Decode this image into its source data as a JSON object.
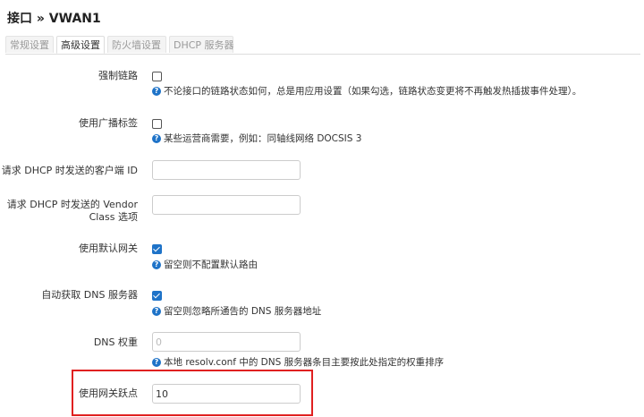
{
  "page": {
    "title": "接口 » VWAN1"
  },
  "tabs": [
    {
      "label": "常规设置",
      "active": false
    },
    {
      "label": "高级设置",
      "active": true
    },
    {
      "label": "防火墙设置",
      "active": false
    },
    {
      "label": "DHCP 服务器",
      "active": false
    }
  ],
  "fields": {
    "force_link": {
      "label": "强制链路",
      "checked": false,
      "help": "不论接口的链路状态如何，总是用应用设置（如果勾选，链路状态变更将不再触发热插拔事件处理）。"
    },
    "broadcast_flag": {
      "label": "使用广播标签",
      "checked": false,
      "help": "某些运营商需要，例如：同轴线网络 DOCSIS 3"
    },
    "client_id": {
      "label": "请求 DHCP 时发送的客户端 ID",
      "value": ""
    },
    "vendor_class": {
      "label_line1": "请求 DHCP 时发送的 Vendor",
      "label_line2": "Class 选项",
      "value": ""
    },
    "default_route": {
      "label": "使用默认网关",
      "checked": true,
      "help": "留空则不配置默认路由"
    },
    "peer_dns": {
      "label": "自动获取 DNS 服务器",
      "checked": true,
      "help": "留空则忽略所通告的 DNS 服务器地址"
    },
    "dns_weight": {
      "label": "DNS 权重",
      "placeholder": "0",
      "help": "本地 resolv.conf 中的 DNS 服务器条目主要按此处指定的权重排序"
    },
    "metric": {
      "label": "使用网关跃点",
      "value": "10"
    }
  },
  "colors": {
    "accent": "#1e73c8",
    "highlight": "#e02020"
  }
}
